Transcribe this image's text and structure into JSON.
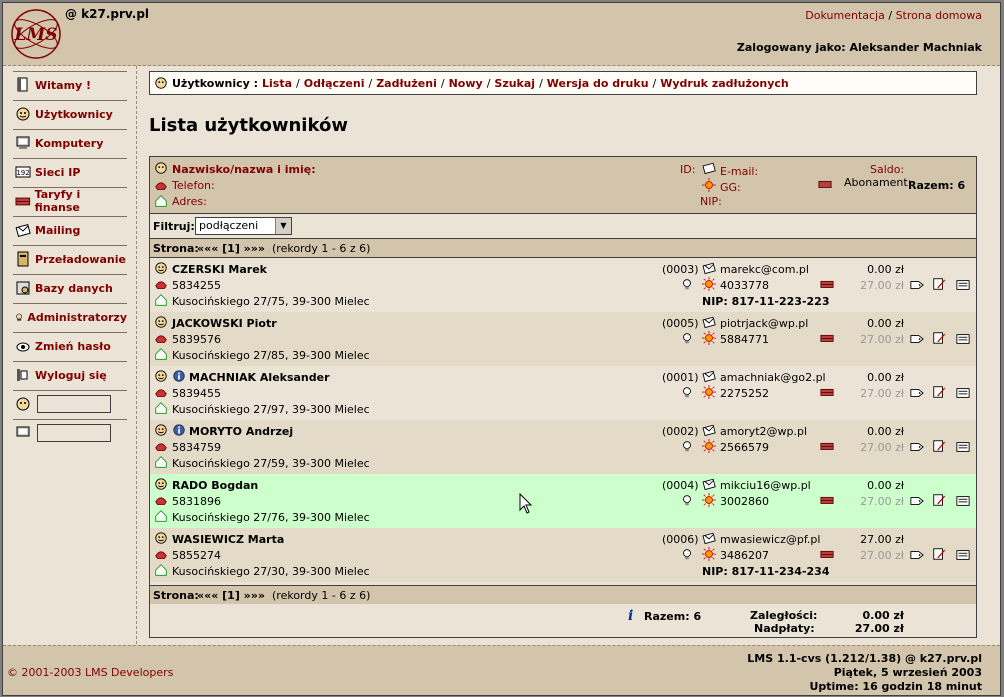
{
  "header": {
    "host": "@ k27.prv.pl",
    "links": [
      "Dokumentacja",
      "Strona domowa"
    ],
    "link_sep": "/",
    "logged": "Zalogowany jako: Aleksander Machniak",
    "logo_text": "LMS"
  },
  "sidebar": {
    "items": [
      {
        "label": "Witamy !",
        "icon": "info-book-icon"
      },
      {
        "label": "Użytkownicy",
        "icon": "user-face-icon"
      },
      {
        "label": "Komputery",
        "icon": "computer-icon"
      },
      {
        "label": "Sieci IP",
        "icon": "network-icon"
      },
      {
        "label": "Taryfy i finanse",
        "icon": "money-bricks-icon"
      },
      {
        "label": "Mailing",
        "icon": "mail-icon"
      },
      {
        "label": "Przeładowanie",
        "icon": "reload-icon"
      },
      {
        "label": "Bazy danych",
        "icon": "database-icon"
      },
      {
        "label": "Administratorzy",
        "icon": "admin-icon"
      },
      {
        "label": "Zmień hasło",
        "icon": "password-icon"
      },
      {
        "label": "Wyloguj się",
        "icon": "logout-icon"
      }
    ]
  },
  "breadcrumb": {
    "prefix": "Użytkownicy :",
    "links": [
      "Lista",
      "Odłączeni",
      "Zadłużeni",
      "Nowy",
      "Szukaj",
      "Wersja do druku",
      "Wydruk zadłużonych"
    ]
  },
  "page_title": "Lista użytkowników",
  "table_header": {
    "name": "Nazwisko/nazwa i imię:",
    "phone": "Telefon:",
    "address": "Adres:",
    "id": "ID:",
    "email": "E-mail:",
    "gg": "GG:",
    "nip": "NIP:",
    "saldo": "Saldo:",
    "abonament": "Abonament:",
    "razem": "Razem: 6"
  },
  "filter": {
    "label": "Filtruj:",
    "value": "podłączeni"
  },
  "pager": {
    "prefix": "Strona:",
    "nav": "«««  [1]  »»»",
    "info": "(rekordy 1 - 6 z 6)"
  },
  "rows": [
    {
      "name": "CZERSKI Marek",
      "phone": "5834255",
      "address": "Kusocińskiego 27/75, 39-300 Mielec",
      "id": "(0003)",
      "email": "marekc@com.pl",
      "gg": "4033778",
      "nip": "NIP: 817-11-223-223",
      "saldo": "0.00 zł",
      "abon": "27.00 zł",
      "info": false,
      "highlight": false
    },
    {
      "name": "JACKOWSKI Piotr",
      "phone": "5839576",
      "address": "Kusocińskiego 27/85, 39-300 Mielec",
      "id": "(0005)",
      "email": "piotrjack@wp.pl",
      "gg": "5884771",
      "nip": "",
      "saldo": "0.00 zł",
      "abon": "27.00 zł",
      "info": false,
      "highlight": false
    },
    {
      "name": "MACHNIAK Aleksander",
      "phone": "5839455",
      "address": "Kusocińskiego 27/97, 39-300 Mielec",
      "id": "(0001)",
      "email": "amachniak@go2.pl",
      "gg": "2275252",
      "nip": "",
      "saldo": "0.00 zł",
      "abon": "27.00 zł",
      "info": true,
      "highlight": false
    },
    {
      "name": "MORYTO Andrzej",
      "phone": "5834759",
      "address": "Kusocińskiego 27/59, 39-300 Mielec",
      "id": "(0002)",
      "email": "amoryt2@wp.pl",
      "gg": "2566579",
      "nip": "",
      "saldo": "0.00 zł",
      "abon": "27.00 zł",
      "info": true,
      "highlight": false
    },
    {
      "name": "RADO Bogdan",
      "phone": "5831896",
      "address": "Kusocińskiego 27/76, 39-300 Mielec",
      "id": "(0004)",
      "email": "mikciu16@wp.pl",
      "gg": "3002860",
      "nip": "",
      "saldo": "0.00 zł",
      "abon": "27.00 zł",
      "info": false,
      "highlight": true
    },
    {
      "name": "WASIEWICZ Marta",
      "phone": "5855274",
      "address": "Kusocińskiego 27/30, 39-300 Mielec",
      "id": "(0006)",
      "email": "mwasiewicz@pf.pl",
      "gg": "3486207",
      "nip": "NIP: 817-11-234-234",
      "saldo": "27.00 zł",
      "abon": "27.00 zł",
      "info": false,
      "highlight": false
    }
  ],
  "summary": {
    "razem": "Razem: 6",
    "zaleglosci_label": "Zaległości:",
    "zaleglosci": "0.00 zł",
    "nadplaty_label": "Nadpłaty:",
    "nadplaty": "27.00 zł"
  },
  "footer": {
    "copyright": "© 2001-2003 LMS Developers",
    "version": "LMS 1.1-cvs (1.212/1.38) @ k27.prv.pl",
    "date": "Piątek, 5 wrzesień 2003",
    "uptime": "Uptime: 16 godzin 18 minut"
  },
  "colors": {
    "accent": "#800000",
    "header_bg": "#d2c5ac",
    "page_bg": "#ebe4d6",
    "row_alt": "#e3dac8",
    "row_highlight": "#ccffcc"
  }
}
